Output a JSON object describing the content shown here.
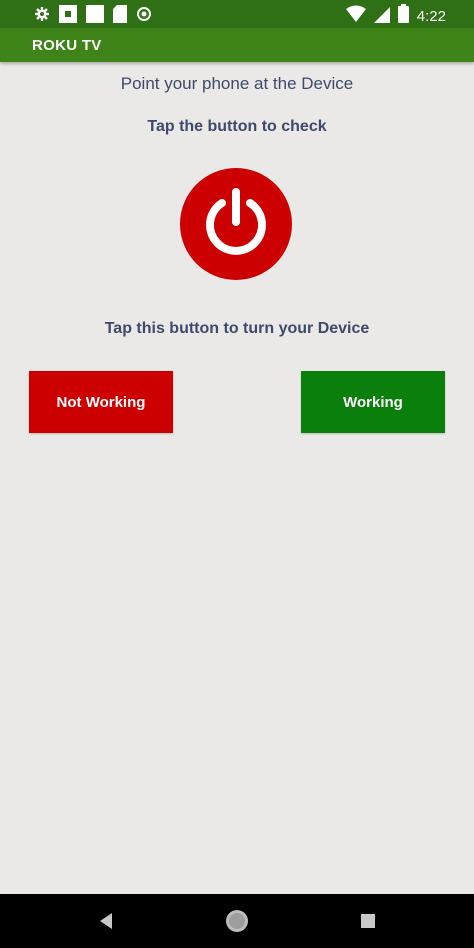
{
  "status_bar": {
    "time": "4:22",
    "left_icons": [
      "settings-icon",
      "notification-icon",
      "notification-icon",
      "sd-card-icon",
      "sync-icon"
    ],
    "right_icons": [
      "wifi-icon",
      "signal-icon",
      "battery-icon"
    ]
  },
  "app_bar": {
    "title": "ROKU TV",
    "color": "#3f8419"
  },
  "main": {
    "instruction_point": "Point your phone at the Device",
    "instruction_tap": "Tap the button to check",
    "instruction_turn": "Tap this button to turn your Device",
    "power_button_icon": "power-icon",
    "power_button_color": "#cc0000"
  },
  "buttons": {
    "not_working_label": "Not Working",
    "not_working_color": "#cc0000",
    "working_label": "Working",
    "working_color": "#0b7f0b"
  },
  "nav_bar": {
    "icons": [
      "back-icon",
      "home-icon",
      "recents-icon"
    ]
  }
}
